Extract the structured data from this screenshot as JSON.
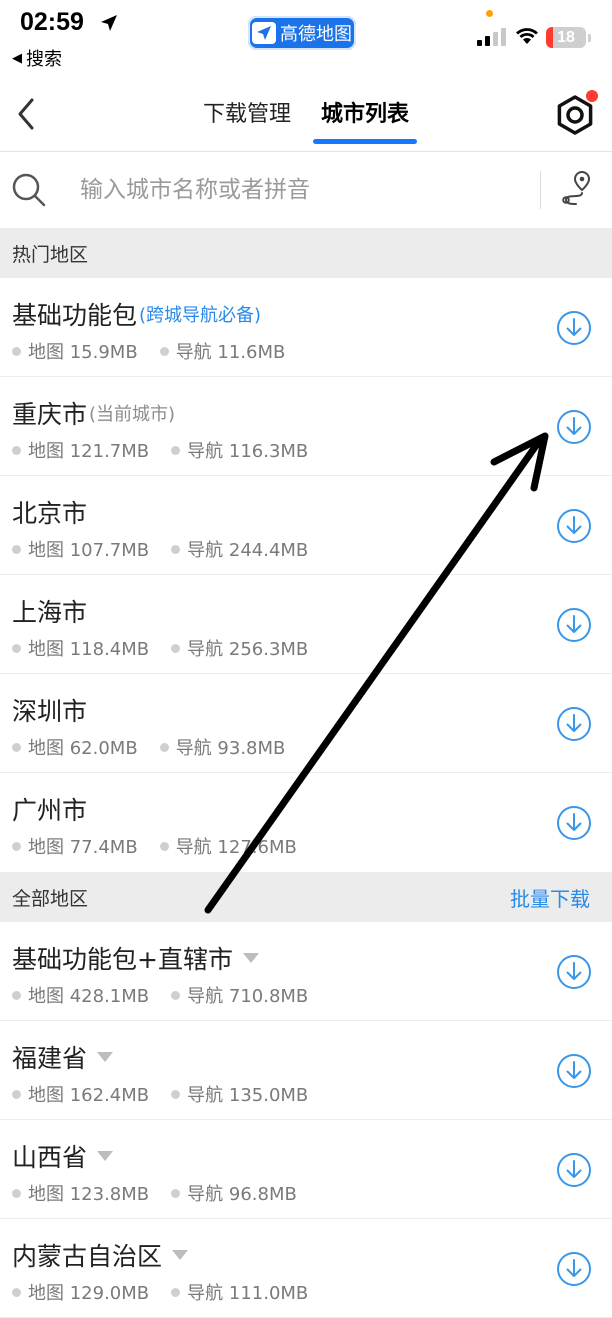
{
  "status_bar": {
    "time": "02:59",
    "back_app": "搜索",
    "app_name": "高德地图",
    "battery": "18",
    "battery_level_pct": 18
  },
  "nav": {
    "tabs": [
      {
        "label": "下载管理",
        "active": false
      },
      {
        "label": "城市列表",
        "active": true
      }
    ]
  },
  "search": {
    "placeholder": "输入城市名称或者拼音"
  },
  "hot_section": {
    "title": "热门地区",
    "items": [
      {
        "name": "基础功能包",
        "tag": "(跨城导航必备)",
        "tag_style": "blue",
        "map": "地图 15.9MB",
        "nav": "导航 11.6MB"
      },
      {
        "name": "重庆市",
        "tag": "(当前城市)",
        "tag_style": "gray",
        "map": "地图 121.7MB",
        "nav": "导航 116.3MB"
      },
      {
        "name": "北京市",
        "map": "地图 107.7MB",
        "nav": "导航 244.4MB"
      },
      {
        "name": "上海市",
        "map": "地图 118.4MB",
        "nav": "导航 256.3MB"
      },
      {
        "name": "深圳市",
        "map": "地图 62.0MB",
        "nav": "导航 93.8MB"
      },
      {
        "name": "广州市",
        "map": "地图 77.4MB",
        "nav": "导航 127.6MB"
      }
    ]
  },
  "all_section": {
    "title": "全部地区",
    "action": "批量下载",
    "items": [
      {
        "name": "基础功能包+直辖市",
        "map": "地图 428.1MB",
        "nav": "导航 710.8MB"
      },
      {
        "name": "福建省",
        "map": "地图 162.4MB",
        "nav": "导航 135.0MB"
      },
      {
        "name": "山西省",
        "map": "地图 123.8MB",
        "nav": "导航 96.8MB"
      },
      {
        "name": "内蒙古自治区",
        "map": "地图 129.0MB",
        "nav": "导航 111.0MB"
      }
    ]
  },
  "colors": {
    "accent": "#1677ff",
    "link": "#2a8ae8",
    "download_icon": "#3a96e8",
    "badge": "#ff3b30"
  },
  "icons": {
    "back": "chevron-left-icon",
    "settings": "hexagon-gear-icon",
    "search": "search-icon",
    "route": "route-pin-icon",
    "download": "download-circle-icon",
    "expand": "caret-down-icon"
  }
}
